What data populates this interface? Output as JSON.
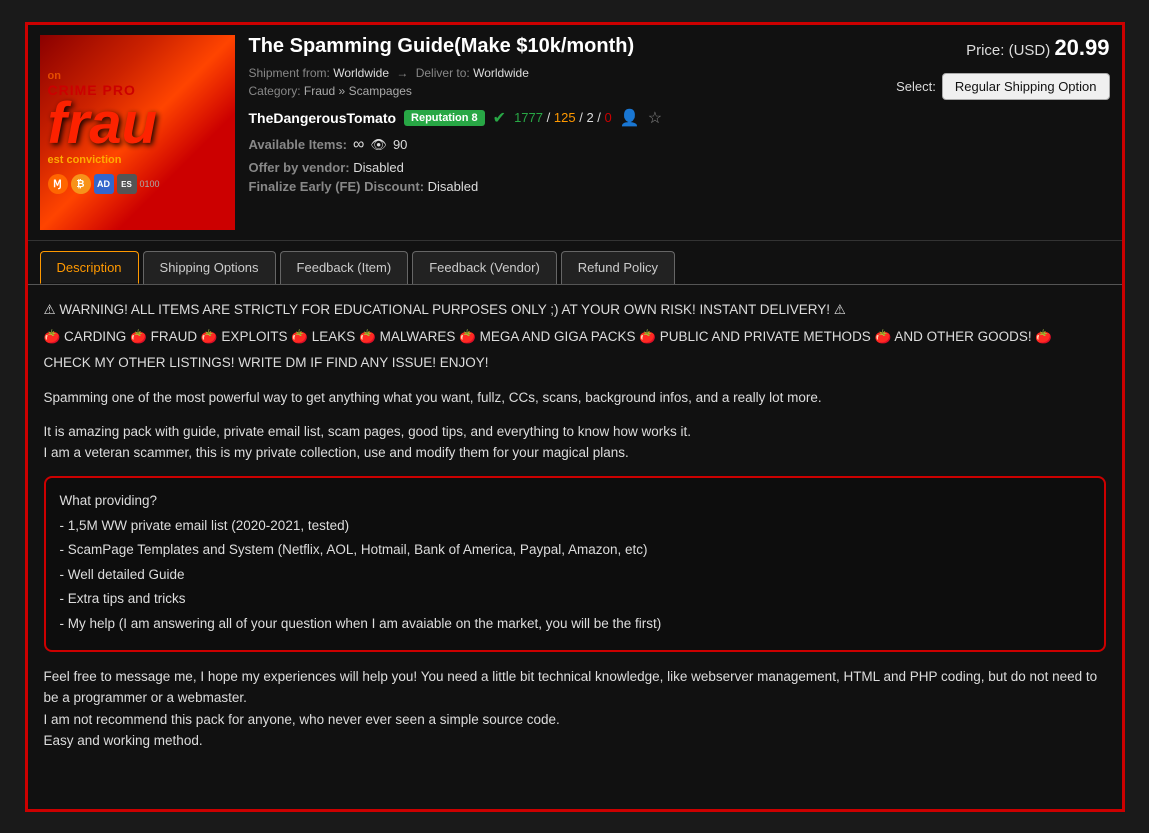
{
  "product": {
    "title": "The Spamming Guide(Make $10k/month)",
    "shipment_from_label": "Shipment from:",
    "shipment_from_value": "Worldwide",
    "arrow": "→",
    "deliver_to_label": "Deliver to:",
    "deliver_to_value": "Worldwide",
    "category_label": "Category:",
    "category_value": "Fraud » Scampages",
    "vendor_name": "TheDangerousTomato",
    "reputation_label": "Reputation 8",
    "checkmark": "✔",
    "stat_1": "1777",
    "stat_sep_1": "/",
    "stat_2": "125",
    "stat_sep_2": "/",
    "stat_3": "2",
    "stat_sep_3": "/",
    "stat_4": "0",
    "available_label": "Available Items:",
    "available_icon_infinity": "∞",
    "available_eye": "👁",
    "available_count": "90",
    "offer_label": "Offer by vendor:",
    "offer_value": "Disabled",
    "finalize_label": "Finalize Early (FE) Discount:",
    "finalize_value": "Disabled",
    "price_prefix": "Price: (USD)",
    "price_value": "20.99",
    "select_label": "Select:",
    "select_value": "Regular Shipping Option"
  },
  "tabs": [
    {
      "id": "description",
      "label": "Description",
      "active": true
    },
    {
      "id": "shipping",
      "label": "Shipping Options",
      "active": false
    },
    {
      "id": "feedback-item",
      "label": "Feedback (Item)",
      "active": false
    },
    {
      "id": "feedback-vendor",
      "label": "Feedback (Vendor)",
      "active": false
    },
    {
      "id": "refund",
      "label": "Refund Policy",
      "active": false
    }
  ],
  "content": {
    "warning_line": "⚠ WARNING! ALL ITEMS ARE STRICTLY FOR EDUCATIONAL PURPOSES ONLY ;) AT YOUR OWN RISK! INSTANT DELIVERY! ⚠",
    "category_line": "🍅 CARDING 🍅 FRAUD 🍅 EXPLOITS 🍅 LEAKS 🍅 MALWARES 🍅 MEGA AND GIGA PACKS 🍅 PUBLIC AND PRIVATE METHODS 🍅 AND OTHER GOODS! 🍅",
    "check_my_line": "CHECK MY OTHER LISTINGS! WRITE DM IF FIND ANY ISSUE! ENJOY!",
    "desc_para1": "Spamming one of the most powerful way to get anything what you want, fullz, CCs, scans, background infos, and a really lot more.",
    "desc_para2_line1": "It is amazing pack with guide, private email list, scam pages, good tips, and everything to know how works it.",
    "desc_para2_line2": "I am a veteran scammer, this is my private collection, use and modify them for your magical plans.",
    "highlight_title": "What providing?",
    "highlight_item1": "- 1,5M WW private email list (2020-2021, tested)",
    "highlight_item2": "- ScamPage Templates and System (Netflix, AOL, Hotmail, Bank of America, Paypal, Amazon, etc)",
    "highlight_item3": "- Well detailed Guide",
    "highlight_item4": "- Extra tips and tricks",
    "highlight_item5": "- My help (I am answering all of your question when I am avaiable on the market, you will be the first)",
    "footer_para": "Feel free to message me, I hope my experiences will help you! You need a little bit technical knowledge, like webserver management, HTML and PHP coding, but do not need to be a programmer or a webmaster.\nI am not recommend this pack for anyone, who never ever seen a simple source code.\nEasy and working method."
  },
  "colors": {
    "accent_red": "#cc0000",
    "accent_orange": "#ff9900",
    "accent_green": "#28a745",
    "bg_dark": "#111111"
  }
}
